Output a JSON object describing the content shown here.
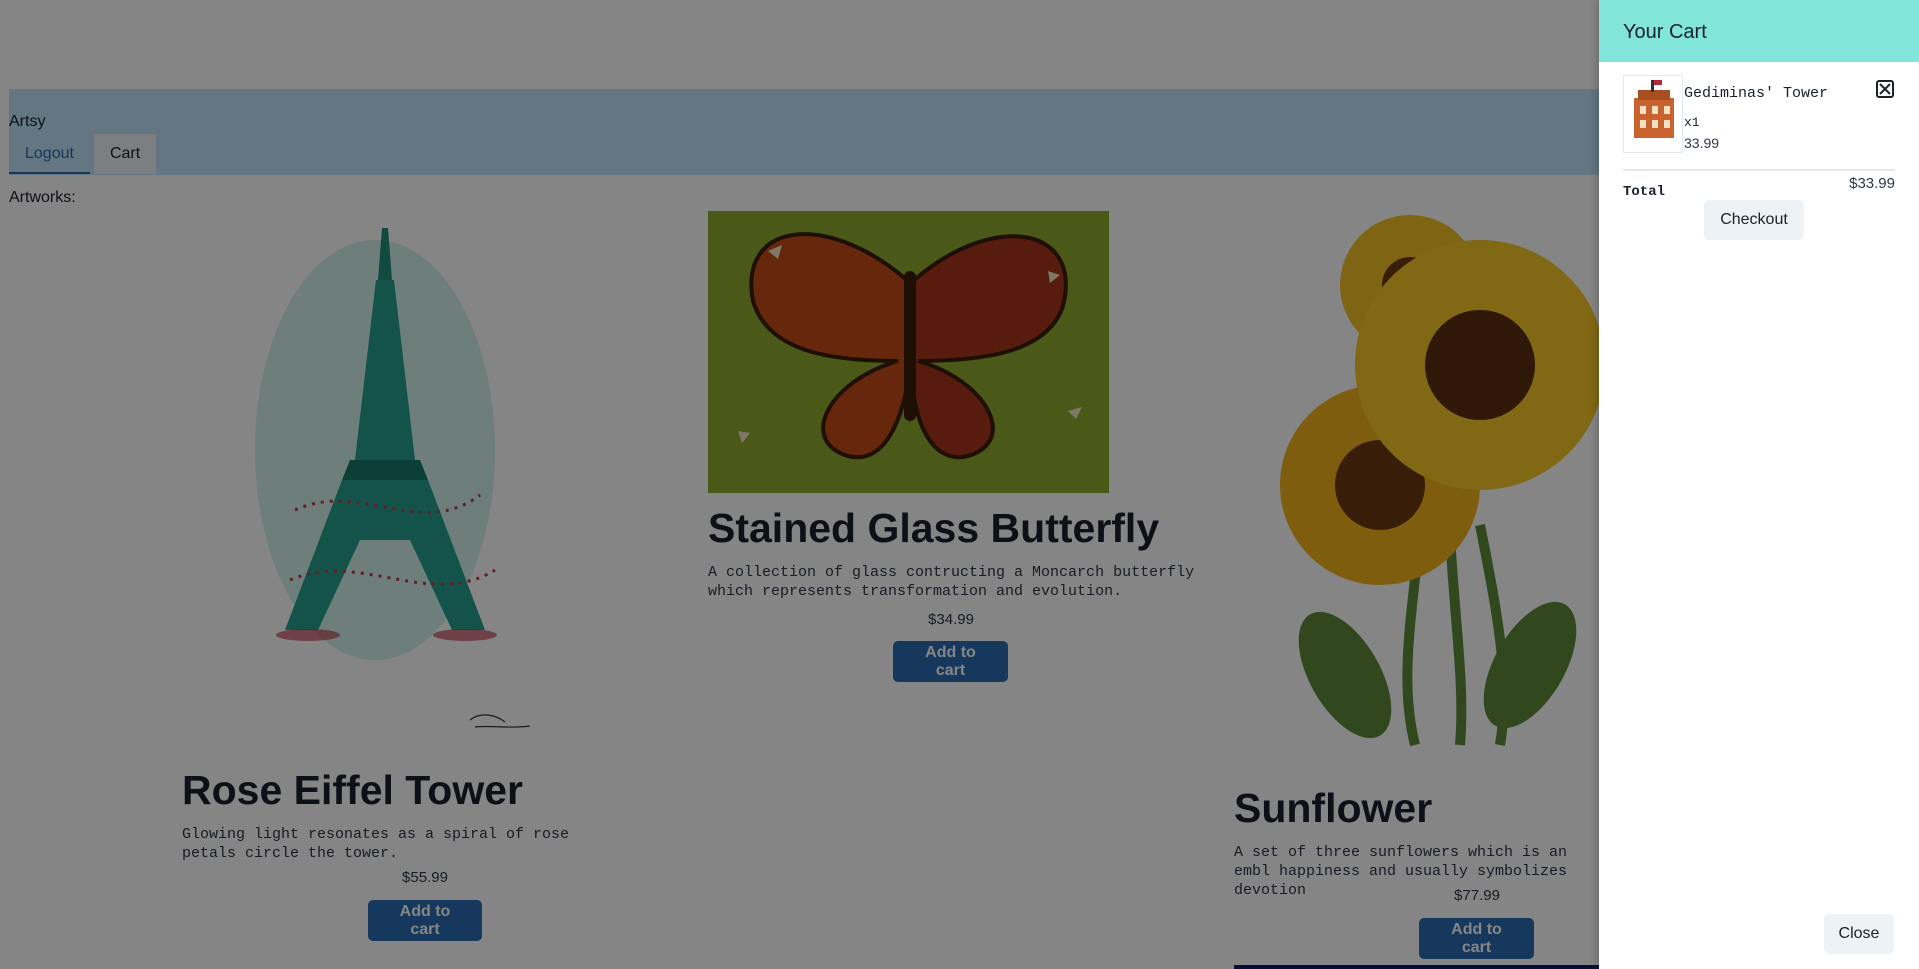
{
  "navbar": {
    "brand": "Artsy",
    "tabs": [
      {
        "label": "Logout",
        "active": true
      },
      {
        "label": "Cart",
        "active": false
      }
    ]
  },
  "main": {
    "artworks_label": "Artworks:",
    "products": [
      {
        "title": "Rose Eiffel Tower",
        "description": "Glowing light resonates as a spiral of rose petals circle the tower.",
        "price": "$55.99",
        "button": "Add to cart",
        "image": "eiffel-tower-illustration"
      },
      {
        "title": "Stained Glass Butterfly",
        "description": "A collection of glass contructing a Moncarch butterfly which represents transformation and evolution.",
        "price": "$34.99",
        "button": "Add to cart",
        "image": "butterfly-illustration"
      },
      {
        "title": "Sunflower",
        "description": "A set of three sunflowers which is an embl happiness and usually symbolizes devotion",
        "price": "$77.99",
        "button": "Add to cart",
        "image": "sunflower-illustration"
      }
    ]
  },
  "cart_drawer": {
    "title": "Your Cart",
    "items": [
      {
        "name": "Gediminas' Tower",
        "quantity": "x1",
        "price": "33.99",
        "thumbnail": "tower-thumbnail"
      }
    ],
    "total_label": "Total",
    "total_value": "$33.99",
    "checkout_label": "Checkout",
    "close_label": "Close"
  },
  "colors": {
    "navbar_bg": "#bee3f8",
    "drawer_header_bg": "#81e6d9",
    "button_blue": "#2b6cb0",
    "overlay": "rgba(0,0,0,0.48)"
  }
}
